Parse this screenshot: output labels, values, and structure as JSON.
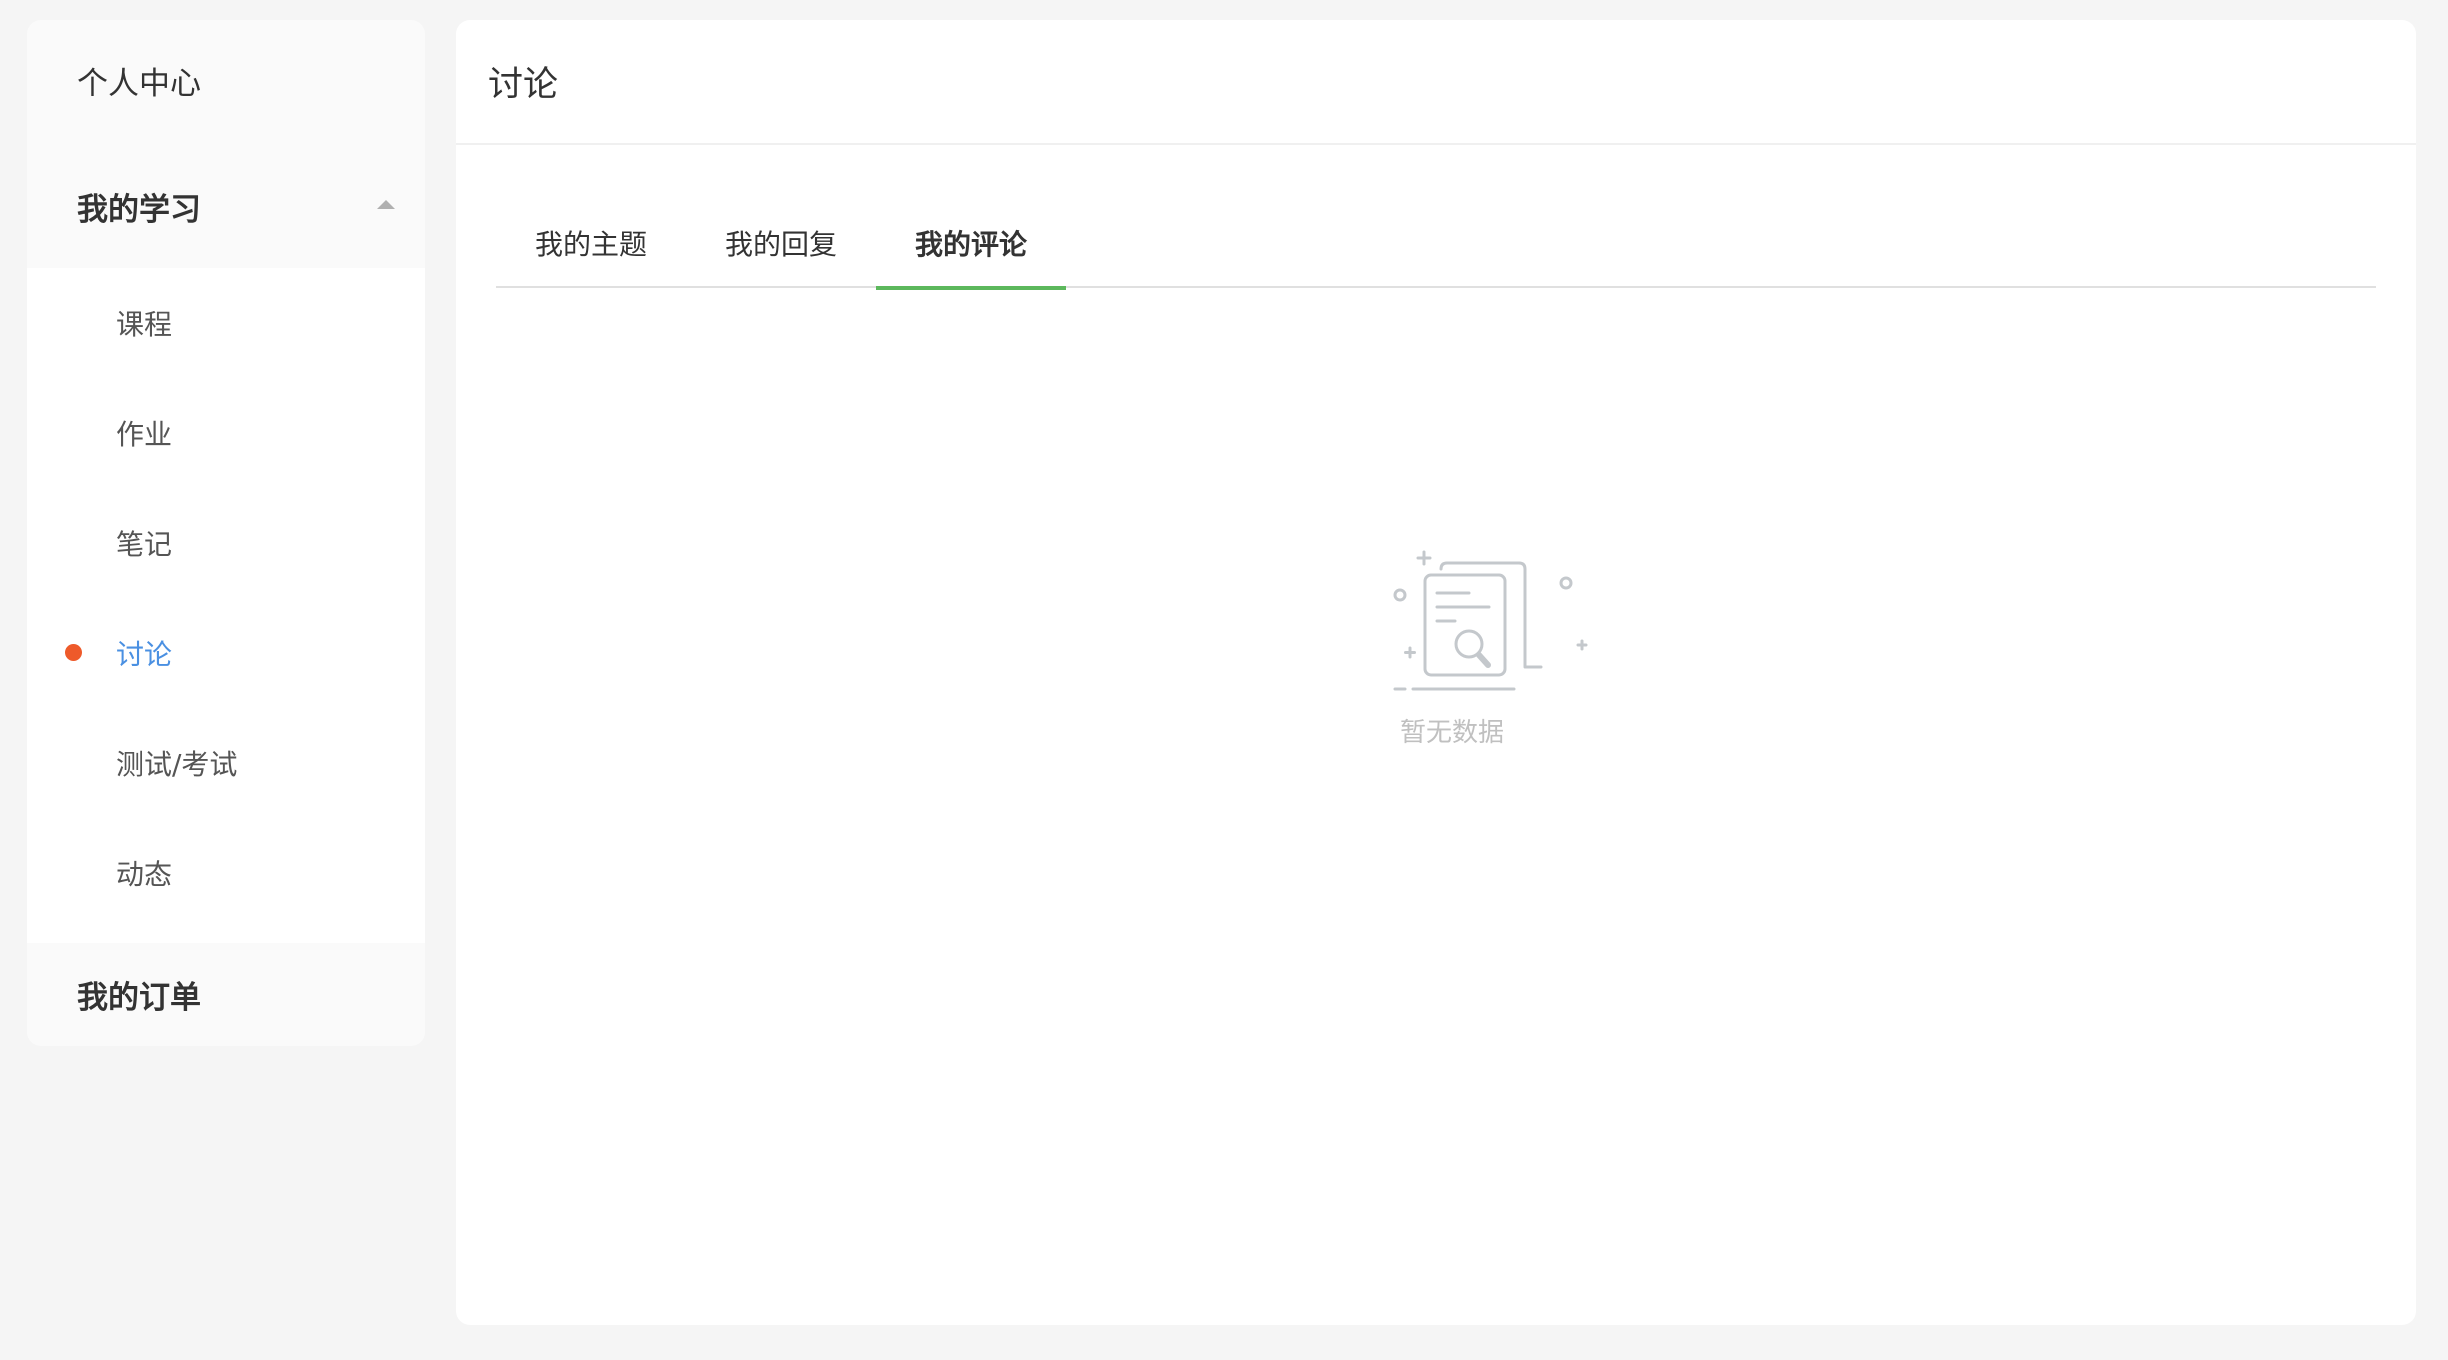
{
  "sidebar": {
    "personal_center": "个人中心",
    "my_study": "我的学习",
    "items": [
      {
        "label": "课程"
      },
      {
        "label": "作业"
      },
      {
        "label": "笔记"
      },
      {
        "label": "讨论"
      },
      {
        "label": "测试/考试"
      },
      {
        "label": "动态"
      }
    ],
    "my_orders": "我的订单",
    "active_index": 3
  },
  "main": {
    "title": "讨论",
    "tabs": [
      {
        "label": "我的主题"
      },
      {
        "label": "我的回复"
      },
      {
        "label": "我的评论"
      }
    ],
    "active_tab": 2,
    "empty_text": "暂无数据"
  },
  "colors": {
    "accent_blue": "#4a90e2",
    "active_dot": "#ee5a2a",
    "tab_underline": "#5cb85c"
  },
  "icons": {
    "caret": "caret-up-icon",
    "empty": "empty-document-search-icon"
  }
}
